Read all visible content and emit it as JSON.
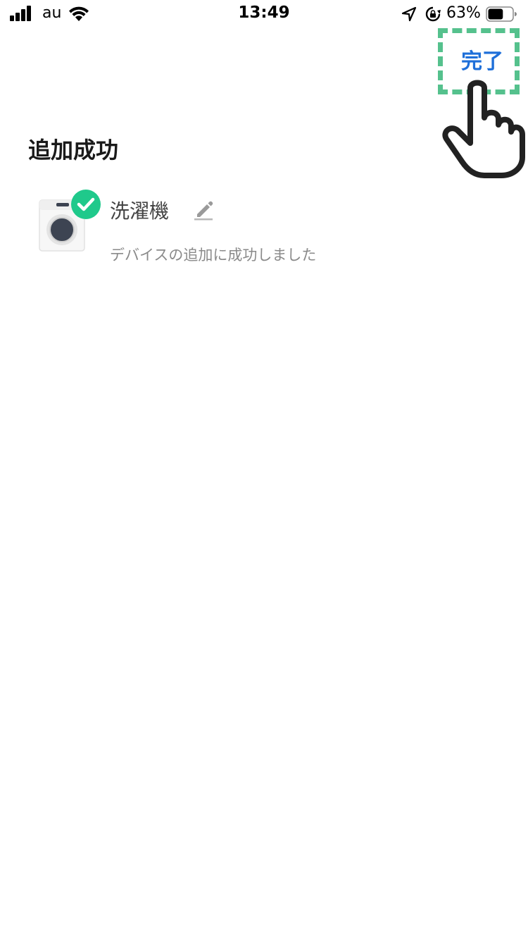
{
  "status_bar": {
    "carrier": "au",
    "time": "13:49",
    "battery_percent": "63%",
    "battery_level": 0.63
  },
  "header": {
    "done_label": "完了"
  },
  "page": {
    "title": "追加成功"
  },
  "device": {
    "name": "洗濯機",
    "status_text": "デバイスの追加に成功しました",
    "icon": "washing-machine-icon",
    "badge_icon": "check-circle-icon",
    "badge_color": "#1fc98b"
  },
  "colors": {
    "accent": "#1e6fd9",
    "highlight": "#55c18d"
  }
}
